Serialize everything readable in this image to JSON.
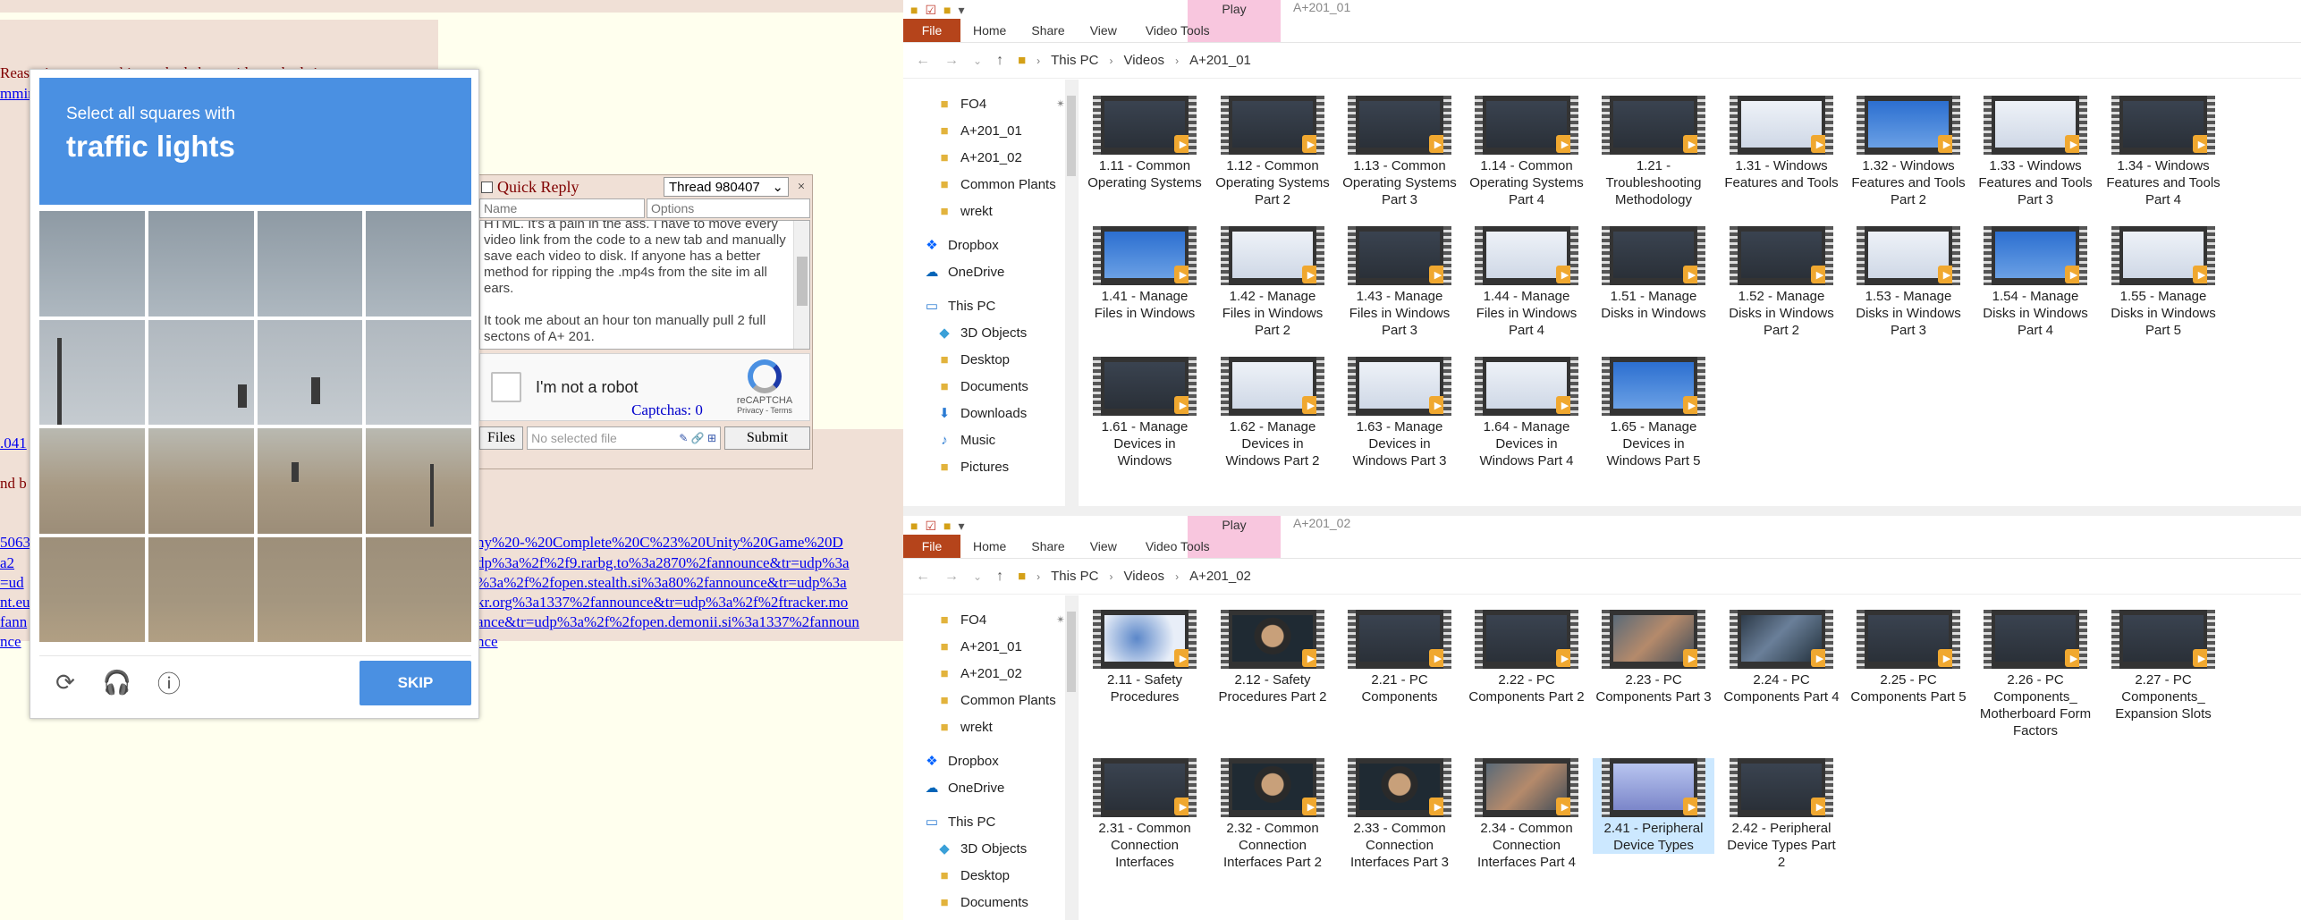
{
  "board": {
    "fragments": [
      {
        "text": "Reasoning  ... something ... bad about video ... bad site ...",
        "cls": "board-red"
      },
      {
        "text": "mmin",
        "cls": "board-link"
      },
      {
        "text": ".041",
        "cls": "board-link"
      },
      {
        "text": "nd b",
        "cls": "board-red"
      }
    ],
    "magnet_lines": [
      "5063",
      "a2",
      "=ud",
      "nt.eu",
      "fann",
      "nce"
    ],
    "magnet_right_lines": [
      "ny%20-%20Complete%20C%23%20Unity%20Game%20D",
      "dp%3a%2f%2f9.rarbg.to%3a2870%2fannounce&tr=udp%3a",
      "%3a%2f%2fopen.stealth.si%3a80%2fannounce&tr=udp%3a",
      "kr.org%3a1337%2fannounce&tr=udp%3a%2f%2ftracker.mo",
      "ance&tr=udp%3a%2f%2fopen.demonii.si%3a1337%2fannoun",
      "nce"
    ]
  },
  "quick_reply": {
    "title": "Quick Reply",
    "thread": "Thread 980407",
    "close": "×",
    "name_placeholder": "Name",
    "options_placeholder": "Options",
    "comment": "HTML. It's a pain in the ass. I have to move every video link from the code to a new tab and manually save each video to disk. If anyone has a better method for ripping the .mp4s from the site im all ears.\n\nIt took me about an hour ton manually pull 2 full sectons of A+ 201.",
    "recaptcha_label": "I'm not a robot",
    "recaptcha_brand": "reCAPTCHA",
    "recaptcha_terms": "Privacy - Terms",
    "captchas": "Captchas: 0",
    "files_button": "Files",
    "file_placeholder": "No selected file",
    "submit": "Submit"
  },
  "challenge": {
    "subtitle": "Select all squares with",
    "object": "traffic lights",
    "skip": "SKIP",
    "icons": [
      "reload-icon",
      "audio-icon",
      "info-icon"
    ]
  },
  "win1": {
    "play_tab": "Play",
    "title": "A+201_01",
    "tabs": [
      "File",
      "Home",
      "Share",
      "View",
      "Video Tools"
    ],
    "breadcrumb": [
      "This PC",
      "Videos",
      "A+201_01"
    ],
    "nav": [
      {
        "label": "FO4",
        "icon": "folder",
        "pin": true
      },
      {
        "label": "A+201_01",
        "icon": "folder"
      },
      {
        "label": "A+201_02",
        "icon": "folder"
      },
      {
        "label": "Common Plants",
        "icon": "folder"
      },
      {
        "label": "wrekt",
        "icon": "folder"
      },
      {
        "label": "Dropbox",
        "icon": "dropbox"
      },
      {
        "label": "OneDrive",
        "icon": "onedrive"
      },
      {
        "label": "This PC",
        "icon": "pc"
      },
      {
        "label": "3D Objects",
        "icon": "obj"
      },
      {
        "label": "Desktop",
        "icon": "folder"
      },
      {
        "label": "Documents",
        "icon": "folder"
      },
      {
        "label": "Downloads",
        "icon": "down"
      },
      {
        "label": "Music",
        "icon": "music"
      },
      {
        "label": "Pictures",
        "icon": "folder"
      }
    ],
    "files": [
      {
        "label": "1.11 - Common Operating Systems",
        "thumb": "t-dark"
      },
      {
        "label": "1.12 - Common Operating Systems Part 2",
        "thumb": "t-dark"
      },
      {
        "label": "1.13 - Common Operating Systems Part 3",
        "thumb": "t-dark"
      },
      {
        "label": "1.14 - Common Operating Systems Part 4",
        "thumb": "t-dark"
      },
      {
        "label": "1.21 - Troubleshooting Methodology",
        "thumb": "t-dark"
      },
      {
        "label": "1.31 - Windows Features and Tools",
        "thumb": "t-light"
      },
      {
        "label": "1.32 - Windows Features and Tools Part 2",
        "thumb": "t-blue"
      },
      {
        "label": "1.33 - Windows Features and Tools Part 3",
        "thumb": "t-light"
      },
      {
        "label": "1.34 - Windows Features and Tools Part 4",
        "thumb": "t-dark"
      },
      {
        "label": "1.41 - Manage Files in Windows",
        "thumb": "t-blue"
      },
      {
        "label": "1.42 - Manage Files in Windows Part 2",
        "thumb": "t-light"
      },
      {
        "label": "1.43 - Manage Files in Windows Part 3",
        "thumb": "t-dark"
      },
      {
        "label": "1.44 - Manage Files in Windows Part 4",
        "thumb": "t-light"
      },
      {
        "label": "1.51 - Manage Disks in Windows",
        "thumb": "t-dark"
      },
      {
        "label": "1.52 - Manage Disks in Windows Part 2",
        "thumb": "t-dark"
      },
      {
        "label": "1.53 - Manage Disks in Windows Part 3",
        "thumb": "t-light"
      },
      {
        "label": "1.54 - Manage Disks in Windows Part 4",
        "thumb": "t-blue"
      },
      {
        "label": "1.55 - Manage Disks in Windows Part 5",
        "thumb": "t-light"
      },
      {
        "label": "1.61 - Manage Devices in Windows",
        "thumb": "t-dark"
      },
      {
        "label": "1.62 - Manage Devices in Windows Part 2",
        "thumb": "t-light"
      },
      {
        "label": "1.63 - Manage Devices in Windows Part 3",
        "thumb": "t-light"
      },
      {
        "label": "1.64 - Manage Devices in Windows Part 4",
        "thumb": "t-light"
      },
      {
        "label": "1.65 - Manage Devices in Windows Part 5",
        "thumb": "t-blue"
      }
    ]
  },
  "win2": {
    "play_tab": "Play",
    "title": "A+201_02",
    "tabs": [
      "File",
      "Home",
      "Share",
      "View",
      "Video Tools"
    ],
    "breadcrumb": [
      "This PC",
      "Videos",
      "A+201_02"
    ],
    "nav": [
      {
        "label": "FO4",
        "icon": "folder",
        "pin": true
      },
      {
        "label": "A+201_01",
        "icon": "folder"
      },
      {
        "label": "A+201_02",
        "icon": "folder"
      },
      {
        "label": "Common Plants",
        "icon": "folder"
      },
      {
        "label": "wrekt",
        "icon": "folder"
      },
      {
        "label": "Dropbox",
        "icon": "dropbox"
      },
      {
        "label": "OneDrive",
        "icon": "onedrive"
      },
      {
        "label": "This PC",
        "icon": "pc"
      },
      {
        "label": "3D Objects",
        "icon": "obj"
      },
      {
        "label": "Desktop",
        "icon": "folder"
      },
      {
        "label": "Documents",
        "icon": "folder"
      }
    ],
    "files": [
      {
        "label": "2.11 - Safety Procedures",
        "thumb": "t-map"
      },
      {
        "label": "2.12 - Safety Procedures Part 2",
        "thumb": "t-person"
      },
      {
        "label": "2.21 - PC Components",
        "thumb": "t-dark"
      },
      {
        "label": "2.22 - PC Components Part 2",
        "thumb": "t-dark"
      },
      {
        "label": "2.23 - PC Components Part 3",
        "thumb": "t-hands"
      },
      {
        "label": "2.24 - PC Components Part 4",
        "thumb": "t-board"
      },
      {
        "label": "2.25 - PC Components Part 5",
        "thumb": "t-dark"
      },
      {
        "label": "2.26 - PC Components_ Motherboard Form Factors",
        "thumb": "t-dark"
      },
      {
        "label": "2.27 - PC Components_ Expansion Slots",
        "thumb": "t-dark"
      },
      {
        "label": "2.31 - Common Connection Interfaces",
        "thumb": "t-dark"
      },
      {
        "label": "2.32 - Common Connection Interfaces Part 2",
        "thumb": "t-person"
      },
      {
        "label": "2.33 - Common Connection Interfaces Part 3",
        "thumb": "t-person"
      },
      {
        "label": "2.34 - Common Connection Interfaces Part 4",
        "thumb": "t-hands"
      },
      {
        "label": "2.41 - Peripheral Device Types",
        "thumb": "t-keys",
        "selected": true
      },
      {
        "label": "2.42 - Peripheral Device Types Part 2",
        "thumb": "t-dark"
      }
    ]
  }
}
